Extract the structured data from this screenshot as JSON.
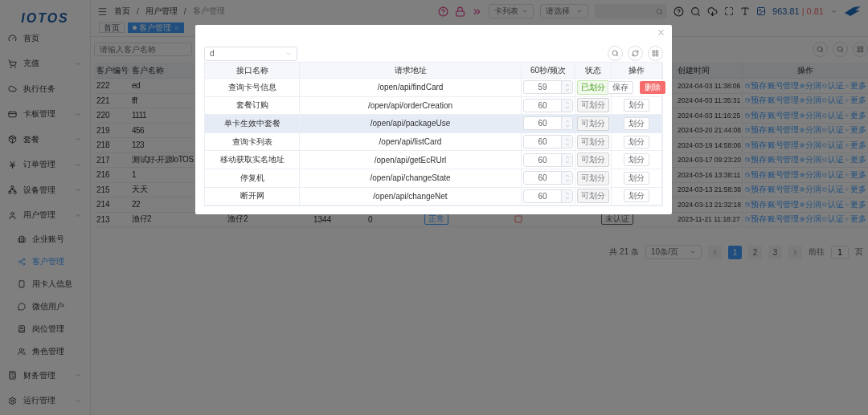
{
  "sidebar": {
    "logo": "IOTOS",
    "items": [
      {
        "label": "首页",
        "kind": "link"
      },
      {
        "label": "充值",
        "kind": "group",
        "expanded": false
      },
      {
        "label": "执行任务",
        "kind": "link"
      },
      {
        "label": "卡板管理",
        "kind": "group",
        "expanded": false
      },
      {
        "label": "套餐",
        "kind": "group",
        "expanded": false
      },
      {
        "label": "订单管理",
        "kind": "group",
        "expanded": false
      },
      {
        "label": "设备管理",
        "kind": "group",
        "expanded": false
      },
      {
        "label": "用户管理",
        "kind": "group",
        "expanded": true,
        "children": [
          {
            "label": "企业账号",
            "selected": false
          },
          {
            "label": "客户管理",
            "selected": true
          },
          {
            "label": "用卡人信息",
            "selected": false
          },
          {
            "label": "微信用户",
            "selected": false
          },
          {
            "label": "岗位管理",
            "selected": false
          },
          {
            "label": "角色管理",
            "selected": false
          }
        ]
      },
      {
        "label": "财务管理",
        "kind": "group",
        "expanded": false
      },
      {
        "label": "运行管理",
        "kind": "group",
        "expanded": false
      }
    ]
  },
  "header": {
    "breadcrumb": [
      "首页",
      "用户管理",
      "客户管理"
    ],
    "crumb_separators": [
      "/",
      "/"
    ],
    "selects": [
      {
        "value": "卡列表"
      },
      {
        "value": "请选择"
      }
    ],
    "balance": "963.81",
    "separator": "|",
    "amount": "0.81"
  },
  "tags": [
    {
      "label": "首页",
      "selected": false
    },
    {
      "label": "客户管理",
      "selected": true
    }
  ],
  "search": {
    "placeholder": "请输入客户名称"
  },
  "table": {
    "columns": [
      "客户编号",
      "客户名称",
      "创建时间",
      "操作"
    ],
    "rows": [
      {
        "id": "222",
        "name": "ed",
        "created": "2024-04-03 11:38:06",
        "actions": [
          "预存",
          "账号管理",
          "分润",
          "认证",
          "更多"
        ]
      },
      {
        "id": "221",
        "name": "fff",
        "created": "2024-04-03 11:35:31",
        "actions": [
          "预存",
          "账号管理",
          "分润",
          "认证",
          "更多"
        ]
      },
      {
        "id": "220",
        "name": "1111",
        "created": "2024-04-03 11:16:25",
        "actions": [
          "预存",
          "账号管理",
          "分润",
          "认证",
          "更多"
        ]
      },
      {
        "id": "219",
        "name": "456",
        "created": "2024-03-20 21:44:08",
        "actions": [
          "预存",
          "账号管理",
          "分润",
          "认证",
          "更多"
        ]
      },
      {
        "id": "218",
        "name": "123",
        "created": "2024-03-19 14:58:06",
        "actions": [
          "预存",
          "账号管理",
          "分润",
          "认证",
          "更多"
        ]
      },
      {
        "id": "217",
        "name": "测试好-开源IoTOS",
        "created": "2024-03-17 09:23:20",
        "actions": [
          "预存",
          "账号管理",
          "分润",
          "认证",
          "更多"
        ]
      },
      {
        "id": "216",
        "name": "1",
        "created": "2024-03-16 13:38:11",
        "actions": [
          "预存",
          "账号管理",
          "分润",
          "认证",
          "更多"
        ]
      },
      {
        "id": "215",
        "name": "天天",
        "created": "2024-03-13 21:58:38",
        "actions": [
          "预存",
          "账号管理",
          "分润",
          "认证",
          "更多"
        ]
      },
      {
        "id": "214",
        "name": "22",
        "created": "2024-03-13 21:32:18",
        "actions": [
          "预存",
          "账号管理",
          "分润",
          "认证",
          "更多"
        ]
      },
      {
        "id": "213",
        "name": "渔仔2",
        "created": "2023-11-21 11:18:27",
        "actions": [
          "预存",
          "账号管理",
          "分润",
          "认证",
          "更多"
        ],
        "middle": {
          "account": "渔仔2",
          "cards": "1344",
          "count": "0",
          "status": "正常",
          "auth": "未认证"
        }
      }
    ]
  },
  "pagination": {
    "total": "共 21 条",
    "page_size": "10条/页",
    "pages": [
      {
        "label": "1",
        "selected": true
      },
      {
        "label": "2",
        "selected": false
      },
      {
        "label": "3",
        "selected": false
      }
    ],
    "goto_label": "前往",
    "goto_value": "1",
    "goto_suffix": "页"
  },
  "dialog": {
    "filter": {
      "value": "d"
    },
    "columns": [
      "接口名称",
      "请求地址",
      "60秒/频次",
      "状态",
      "操作"
    ],
    "rows": [
      {
        "name": "查询卡号信息",
        "path": "/open/api/findCard",
        "limit": "59",
        "status": {
          "label": "已划分",
          "kind": "assigned"
        },
        "hovered": false,
        "actions": [
          {
            "label": "保存",
            "kind": "default"
          },
          {
            "label": "删除",
            "kind": "danger"
          }
        ]
      },
      {
        "name": "套餐订购",
        "path": "/open/api/orderCreation",
        "limit": "60",
        "status": {
          "label": "可划分",
          "kind": "available"
        },
        "hovered": false,
        "actions": [
          {
            "label": "划分",
            "kind": "default"
          }
        ]
      },
      {
        "name": "单卡生效中套餐",
        "path": "/open/api/packageUse",
        "limit": "60",
        "status": {
          "label": "可划分",
          "kind": "available"
        },
        "hovered": true,
        "actions": [
          {
            "label": "划分",
            "kind": "default"
          }
        ]
      },
      {
        "name": "查询卡列表",
        "path": "/open/api/listCard",
        "limit": "60",
        "status": {
          "label": "可划分",
          "kind": "available"
        },
        "hovered": false,
        "actions": [
          {
            "label": "划分",
            "kind": "default"
          }
        ]
      },
      {
        "name": "移动获取实名地址",
        "path": "/open/api/getEcRUrl",
        "limit": "60",
        "status": {
          "label": "可划分",
          "kind": "available"
        },
        "hovered": false,
        "actions": [
          {
            "label": "划分",
            "kind": "default"
          }
        ]
      },
      {
        "name": "停复机",
        "path": "/open/api/changeState",
        "limit": "60",
        "status": {
          "label": "可划分",
          "kind": "available"
        },
        "hovered": false,
        "actions": [
          {
            "label": "划分",
            "kind": "default"
          }
        ]
      },
      {
        "name": "断开网",
        "path": "/open/api/changeNet",
        "limit": "60",
        "status": {
          "label": "可划分",
          "kind": "available"
        },
        "hovered": false,
        "actions": [
          {
            "label": "划分",
            "kind": "default"
          }
        ]
      }
    ]
  }
}
